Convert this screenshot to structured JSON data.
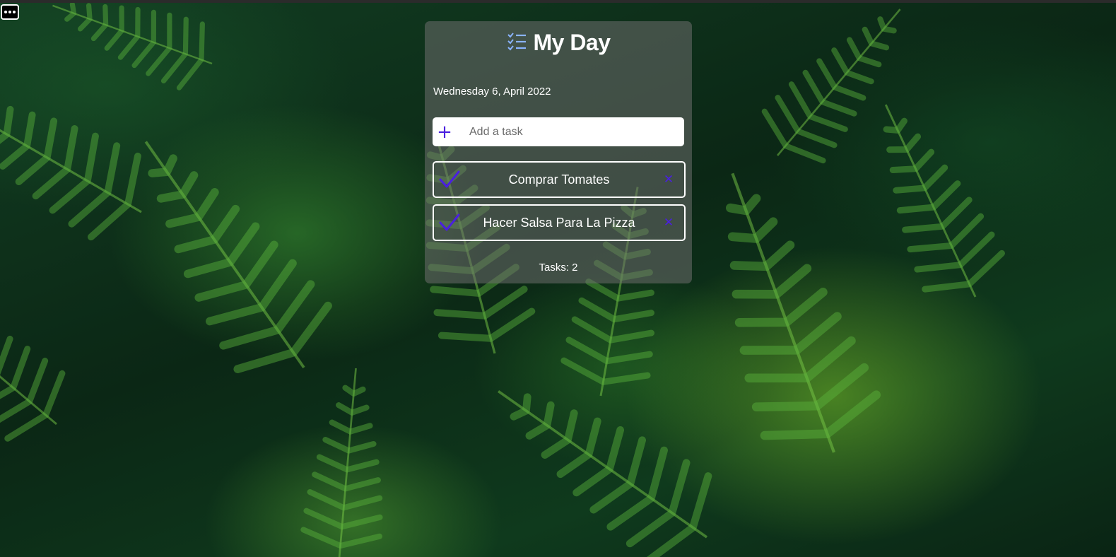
{
  "app": {
    "title": "My Day",
    "date": "Wednesday 6, April 2022",
    "accent_color": "#4a1fe0"
  },
  "add_task": {
    "placeholder": "Add a task",
    "icon": "plus-icon"
  },
  "tasks": [
    {
      "label": "Comprar Tomates",
      "check_icon": "checkmark-icon",
      "delete_icon": "close-icon"
    },
    {
      "label": "Hacer Salsa Para La Pizza",
      "check_icon": "checkmark-icon",
      "delete_icon": "close-icon"
    }
  ],
  "footer": {
    "task_count": "Tasks: 2"
  },
  "menu": {
    "icon": "more-options-icon"
  }
}
